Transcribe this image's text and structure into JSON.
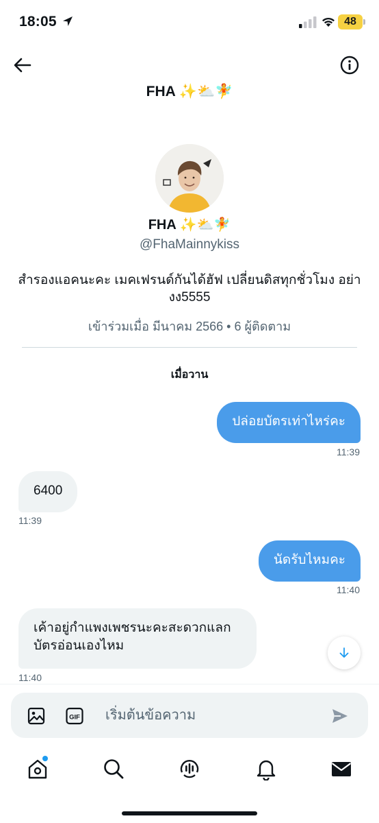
{
  "status_bar": {
    "time": "18:05",
    "battery": "48"
  },
  "header": {
    "title": "FHA ✨⛅🧚"
  },
  "profile": {
    "name": "FHA ✨⛅🧚",
    "handle": "@FhaMainnykiss",
    "bio": "สำรองแอคนะคะ เมคเฟรนด์กันได้ฮัฟ เปลี่ยนดิสทุกชั่วโมง อย่า งง5555",
    "meta": "เข้าร่วมเมื่อ มีนาคม 2566 • 6 ผู้ติดตาม"
  },
  "conversation": {
    "date_separator": "เมื่อวาน",
    "messages": [
      {
        "direction": "out",
        "text": "ปล่อยบัตรเท่าไหร่คะ",
        "time": "11:39"
      },
      {
        "direction": "in",
        "text": "6400",
        "time": "11:39"
      },
      {
        "direction": "out",
        "text": "นัดรับไหมคะ",
        "time": "11:40"
      },
      {
        "direction": "in",
        "text": "เค้าอยู่กำแพงเพชรนะคะสะดวกแลกบัตรอ่อนเองไหม",
        "time": "11:40"
      }
    ]
  },
  "composer": {
    "placeholder": "เริ่มต้นข้อความ"
  },
  "icons": {
    "back": "arrow-left-icon",
    "info": "info-circle-icon",
    "image": "image-icon",
    "gif": "gif-icon",
    "send": "send-icon",
    "scroll": "arrow-down-icon",
    "nav": [
      "home-icon",
      "search-icon",
      "spaces-icon",
      "notifications-icon",
      "messages-icon"
    ]
  },
  "colors": {
    "outgoing_bubble": "#4a9cea",
    "incoming_bubble": "#eff3f4",
    "accent": "#1d9bf0",
    "battery": "#f6d142"
  }
}
